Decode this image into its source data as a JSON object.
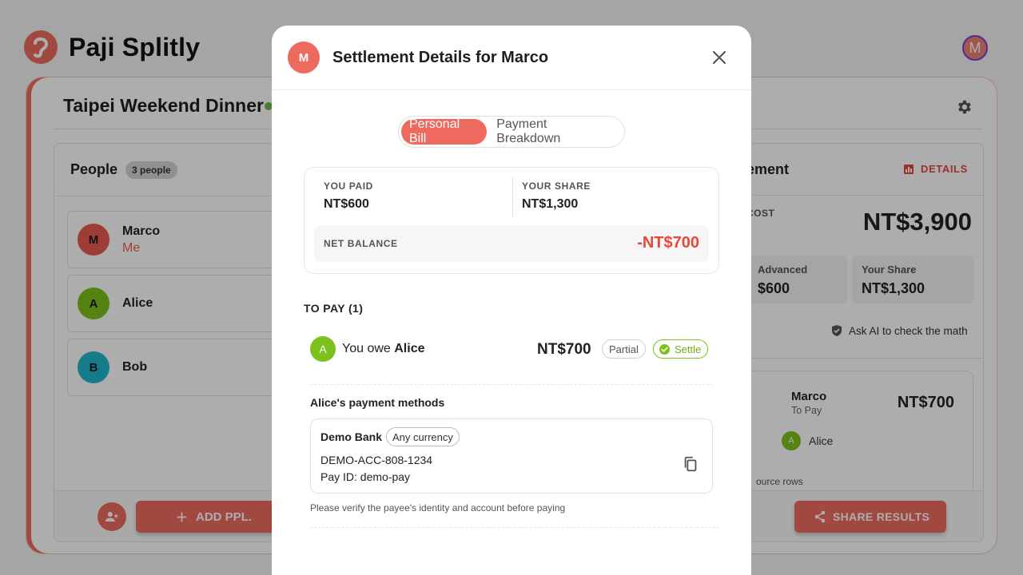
{
  "app": {
    "title": "Paji Splitly",
    "user_initial": "M"
  },
  "board": {
    "title": "Taipei Weekend Dinner",
    "people": {
      "title": "People",
      "count_badge": "3 people",
      "list": [
        {
          "initial": "M",
          "name": "Marco",
          "tag": "Me",
          "color": "#e65c4f"
        },
        {
          "initial": "A",
          "name": "Alice",
          "tag": "",
          "color": "#7cc11e"
        },
        {
          "initial": "B",
          "name": "Bob",
          "tag": "",
          "color": "#1fb6c9"
        }
      ],
      "add_button": "ADD PPL."
    },
    "settlement": {
      "title_visible": "ement",
      "details_link": "DETAILS",
      "cost_label": "COST",
      "cost_value": "NT$3,900",
      "advanced_label": "Advanced",
      "advanced_value": "$600",
      "share_label": "Your Share",
      "share_value": "NT$1,300",
      "ask_ai": "Ask AI to check the math",
      "item": {
        "name": "Marco",
        "sub": "To Pay",
        "amount": "NT$700",
        "payee": "Alice",
        "payee_initial": "A"
      },
      "source_rows": "ource rows",
      "share_button": "SHARE RESULTS"
    }
  },
  "modal": {
    "avatar_initial": "M",
    "title": "Settlement Details for Marco",
    "tabs": {
      "active": "Personal Bill",
      "inactive": "Payment Breakdown"
    },
    "summary": {
      "you_paid_label": "YOU PAID",
      "you_paid_value": "NT$600",
      "your_share_label": "YOUR SHARE",
      "your_share_value": "NT$1,300",
      "net_label": "NET BALANCE",
      "net_value": "-NT$700"
    },
    "to_pay": {
      "heading": "TO PAY (1)",
      "payee_initial": "A",
      "owe_prefix": "You owe",
      "payee_name": "Alice",
      "amount": "NT$700",
      "partial_label": "Partial",
      "settle_label": "Settle"
    },
    "payment_methods": {
      "heading": "Alice's payment methods",
      "bank_name": "Demo Bank",
      "currency_tag": "Any currency",
      "account": "DEMO-ACC-808-1234",
      "pay_id": "Pay ID: demo-pay",
      "verify_note": "Please verify the payee's identity and account before paying"
    }
  },
  "colors": {
    "accent": "#ee6a5f",
    "negative": "#e8483c",
    "success": "#7cc11e"
  }
}
